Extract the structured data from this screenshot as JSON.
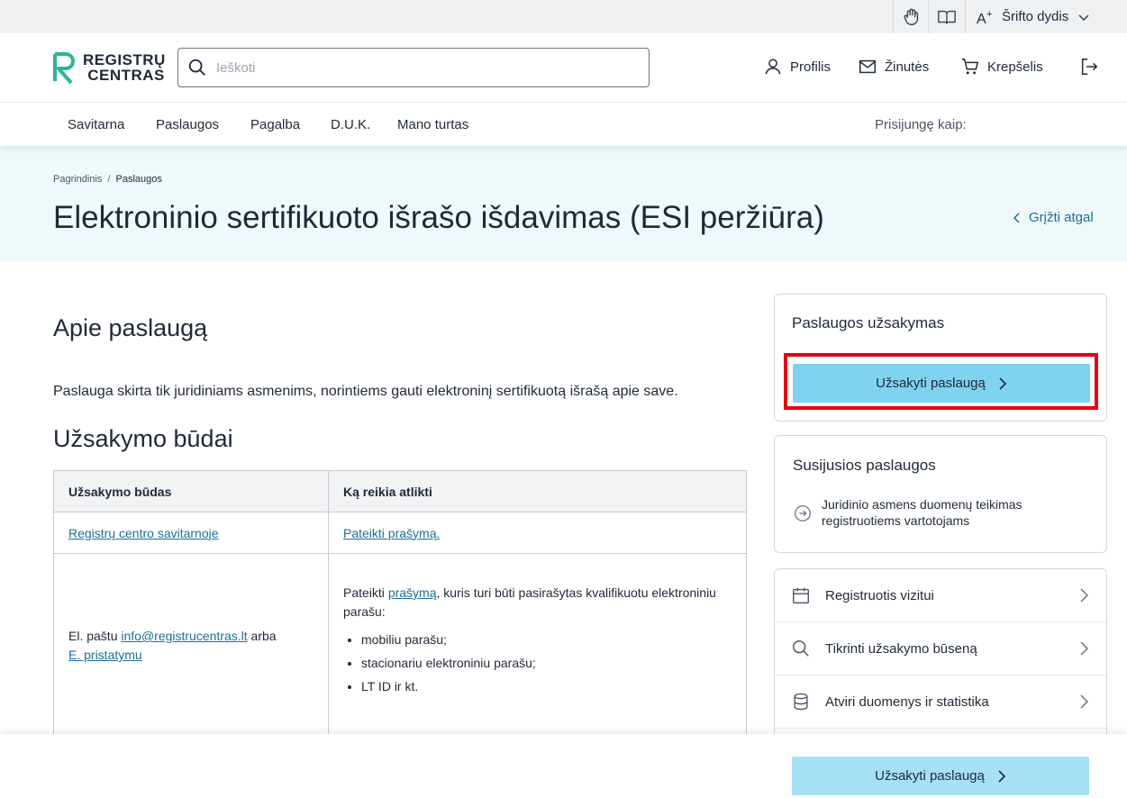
{
  "topbar": {
    "icons": [
      "sign-language-icon",
      "book-icon"
    ],
    "font_size_label": "Šrifto dydis"
  },
  "header": {
    "logo": "REGISTRŲ CENTRAS",
    "search_placeholder": "Ieškoti",
    "links": [
      "Profilis",
      "Žinutės",
      "Krepšelis"
    ]
  },
  "nav": {
    "items": [
      "Savitarna",
      "Paslaugos",
      "Pagalba",
      "D.U.K.",
      "Mano turtas"
    ],
    "login_label": "Prisijungę kaip:"
  },
  "hero": {
    "breadcrumb": [
      "Pagrindinis",
      "Paslaugos"
    ],
    "title": "Elektroninio sertifikuoto išrašo išdavimas (ESI peržiūra)",
    "back_label": "Grįžti atgal"
  },
  "main": {
    "about_heading": "Apie paslaugą",
    "about_text": "Paslauga skirta tik juridiniams asmenims, norintiems gauti elektroninį sertifikuotą išrašą apie save.",
    "methods_heading": "Užsakymo būdai",
    "table": {
      "headers": [
        "Užsakymo būdas",
        "Ką reikia atlikti"
      ],
      "row1": {
        "method": "Registrų centro savitarnoje",
        "action": "Pateikti prašymą."
      },
      "row2": {
        "method_prefix": "El. paštu",
        "email": "info@registrucentras.lt",
        "method_middle": "arba",
        "delivery": "E. pristatymu",
        "action_prefix": "Pateikti",
        "action_link": "prašymą",
        "action_suffix": ", kuris turi būti pasirašytas kvalifikuotu elektroniniu parašu:",
        "bullets": [
          "mobiliu parašu;",
          "stacionariu elektroniniu parašu;",
          "LT ID ir kt."
        ]
      }
    }
  },
  "sidebar": {
    "order_title": "Paslaugos užsakymas",
    "order_button": "Užsakyti paslaugą",
    "related_title": "Susijusios paslaugos",
    "related_item": "Juridinio asmens duomenų teikimas registruotiems vartotojams",
    "menu": [
      "Registruotis vizitui",
      "Tikrinti užsakymo būseną",
      "Atviri duomenys ir statistika"
    ]
  },
  "bottom_bar": {
    "order_button": "Užsakyti paslaugą"
  },
  "colors": {
    "accent_button": "#7fd2f0",
    "link": "#1b6f95",
    "hero_bg": "#eff8fb",
    "highlight": "#e60012",
    "logo_green": "#2bb59a"
  }
}
